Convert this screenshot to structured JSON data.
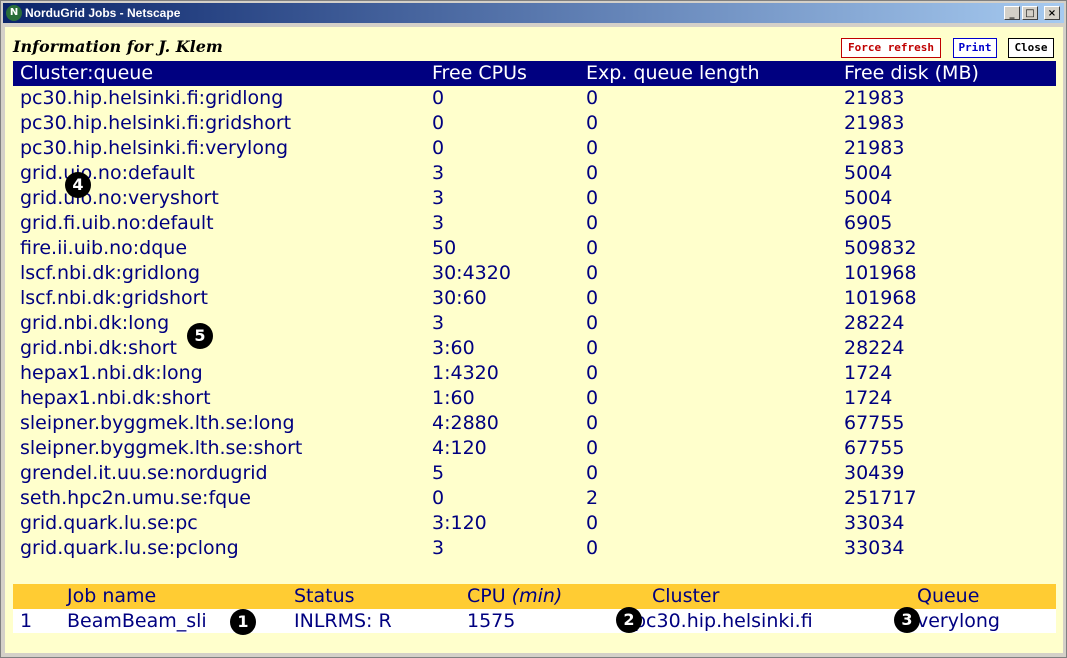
{
  "window": {
    "title": "NorduGrid Jobs - Netscape",
    "app_icon": "N",
    "buttons": {
      "minimize": "_",
      "maximize": "□",
      "close": "×"
    }
  },
  "page": {
    "heading": "Information for J. Klem",
    "buttons": {
      "refresh": "Force refresh",
      "print": "Print",
      "close": "Close"
    }
  },
  "queues": {
    "headers": [
      "Cluster:queue",
      "Free CPUs",
      "Exp. queue length",
      "Free disk (MB)"
    ],
    "rows": [
      [
        "pc30.hip.helsinki.fi:gridlong",
        "0",
        "0",
        "21983"
      ],
      [
        "pc30.hip.helsinki.fi:gridshort",
        "0",
        "0",
        "21983"
      ],
      [
        "pc30.hip.helsinki.fi:verylong",
        "0",
        "0",
        "21983"
      ],
      [
        "grid.uio.no:default",
        "3",
        "0",
        "5004"
      ],
      [
        "grid.uio.no:veryshort",
        "3",
        "0",
        "5004"
      ],
      [
        "grid.fi.uib.no:default",
        "3",
        "0",
        "6905"
      ],
      [
        "fire.ii.uib.no:dque",
        "50",
        "0",
        "509832"
      ],
      [
        "lscf.nbi.dk:gridlong",
        "30:4320",
        "0",
        "101968"
      ],
      [
        "lscf.nbi.dk:gridshort",
        "30:60",
        "0",
        "101968"
      ],
      [
        "grid.nbi.dk:long",
        "3",
        "0",
        "28224"
      ],
      [
        "grid.nbi.dk:short",
        "3:60",
        "0",
        "28224"
      ],
      [
        "hepax1.nbi.dk:long",
        "1:4320",
        "0",
        "1724"
      ],
      [
        "hepax1.nbi.dk:short",
        "1:60",
        "0",
        "1724"
      ],
      [
        "sleipner.byggmek.lth.se:long",
        "4:2880",
        "0",
        "67755"
      ],
      [
        "sleipner.byggmek.lth.se:short",
        "4:120",
        "0",
        "67755"
      ],
      [
        "grendel.it.uu.se:nordugrid",
        "5",
        "0",
        "30439"
      ],
      [
        "seth.hpc2n.umu.se:fque",
        "0",
        "2",
        "251717"
      ],
      [
        "grid.quark.lu.se:pc",
        "3:120",
        "0",
        "33034"
      ],
      [
        "grid.quark.lu.se:pclong",
        "3",
        "0",
        "33034"
      ]
    ]
  },
  "jobs": {
    "headers": {
      "num": "",
      "name": "Job name",
      "status": "Status",
      "cpu": "CPU ",
      "cpu_unit": "(min)",
      "cluster": "Cluster",
      "queue": "Queue"
    },
    "rows": [
      {
        "num": "1",
        "name": "BeamBeam_sli",
        "status": "INLRMS: R",
        "cpu": "1575",
        "cluster": "pc30.hip.helsinki.fi",
        "queue": "verylong"
      }
    ]
  },
  "markers": [
    "1",
    "2",
    "3",
    "4",
    "5"
  ]
}
